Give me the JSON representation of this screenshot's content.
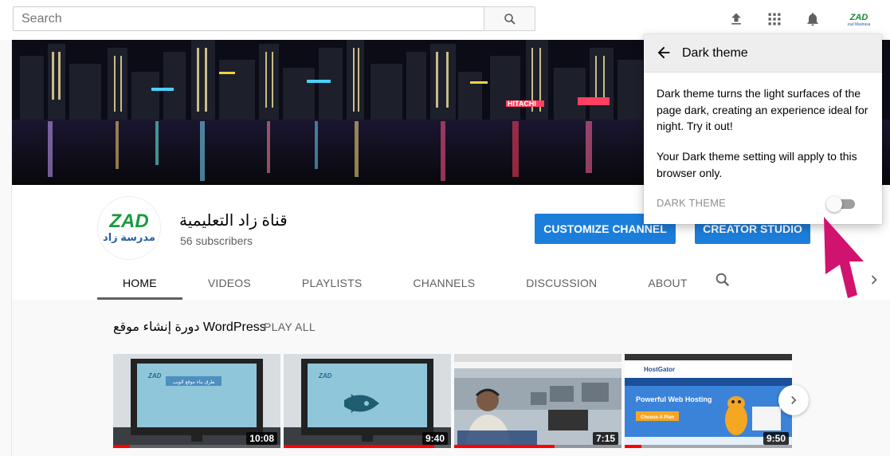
{
  "search": {
    "placeholder": "Search"
  },
  "topbar": {
    "icons": [
      "search-icon",
      "upload-icon",
      "apps-icon",
      "bell-icon"
    ],
    "avatar_text": "ZAD",
    "avatar_subtext": "zad Madrasa"
  },
  "channel": {
    "name": "قناة زاد التعليمية",
    "subscribers": "56 subscribers",
    "avatar_logo": "ZAD",
    "avatar_caption": "مدرسة زاد",
    "customize_label": "CUSTOMIZE CHANNEL",
    "studio_label": "CREATOR STUDIO"
  },
  "tabs": [
    {
      "label": "HOME",
      "active": true
    },
    {
      "label": "VIDEOS"
    },
    {
      "label": "PLAYLISTS"
    },
    {
      "label": "CHANNELS"
    },
    {
      "label": "DISCUSSION"
    },
    {
      "label": "ABOUT"
    }
  ],
  "shelf": {
    "title_ar": "دورة إنشاء موقع",
    "title_en": "WordPress",
    "play_all": "PLAY ALL",
    "videos": [
      {
        "duration": "10:08",
        "caption": "طرق بناء موقع الويب",
        "watched": 0.1
      },
      {
        "duration": "9:40",
        "caption": "",
        "watched": 0.9
      },
      {
        "duration": "7:15",
        "caption": "",
        "watched": 0.6
      },
      {
        "duration": "9:50",
        "caption": "Powerful Web Hosting",
        "subcaption": "Choose A Plan",
        "brand": "HostGator",
        "watched": 0.1
      }
    ]
  },
  "popup": {
    "title": "Dark theme",
    "paragraph1": "Dark theme turns the light surfaces of the page dark, creating an experience ideal for night. Try it out!",
    "paragraph2": "Your Dark theme setting will apply to this browser only.",
    "toggle_label": "DARK THEME",
    "toggle_on": false
  },
  "colors": {
    "accent": "#1c7edb",
    "pointer": "#d0136f",
    "progress": "#ff0000"
  }
}
